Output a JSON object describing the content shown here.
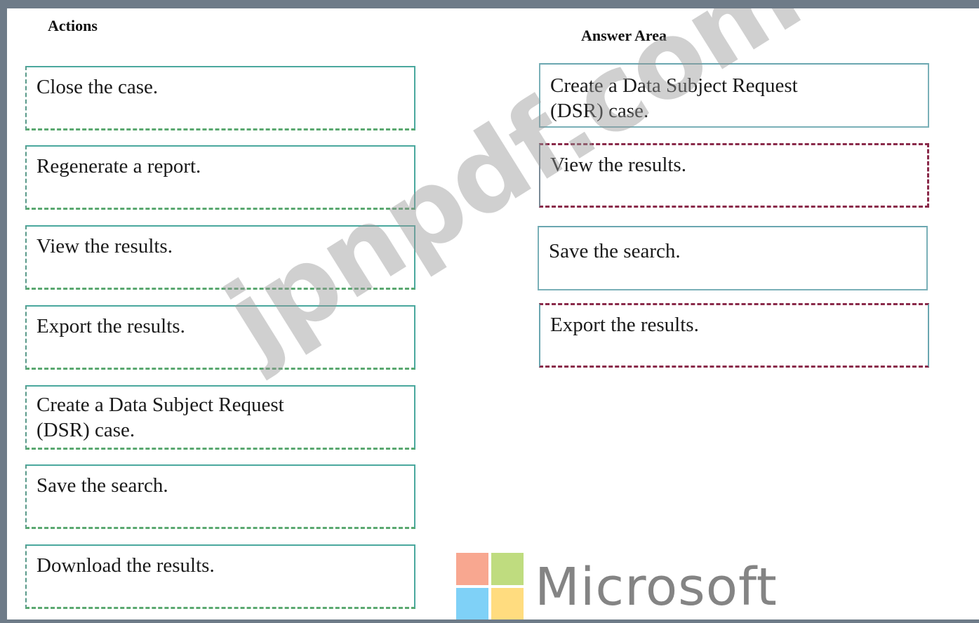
{
  "headings": {
    "actions": "Actions",
    "answer_area": "Answer Area"
  },
  "actions": [
    {
      "label": "Close the case."
    },
    {
      "label": "Regenerate a report."
    },
    {
      "label": "View the results."
    },
    {
      "label": "Export the results."
    },
    {
      "label": "Create a Data Subject Request (DSR) case."
    },
    {
      "label": "Save the search."
    },
    {
      "label": "Download the results."
    }
  ],
  "answers": [
    {
      "label": "Create a Data Subject Request (DSR) case."
    },
    {
      "label": "View the results."
    },
    {
      "label": "Save the search."
    },
    {
      "label": "Export the results."
    }
  ],
  "watermark": {
    "text": "jpnpdf.com"
  },
  "branding": {
    "word": "Microsoft",
    "logo_colors": [
      "#f25022",
      "#7fba00",
      "#00a4ef",
      "#ffb900"
    ]
  }
}
